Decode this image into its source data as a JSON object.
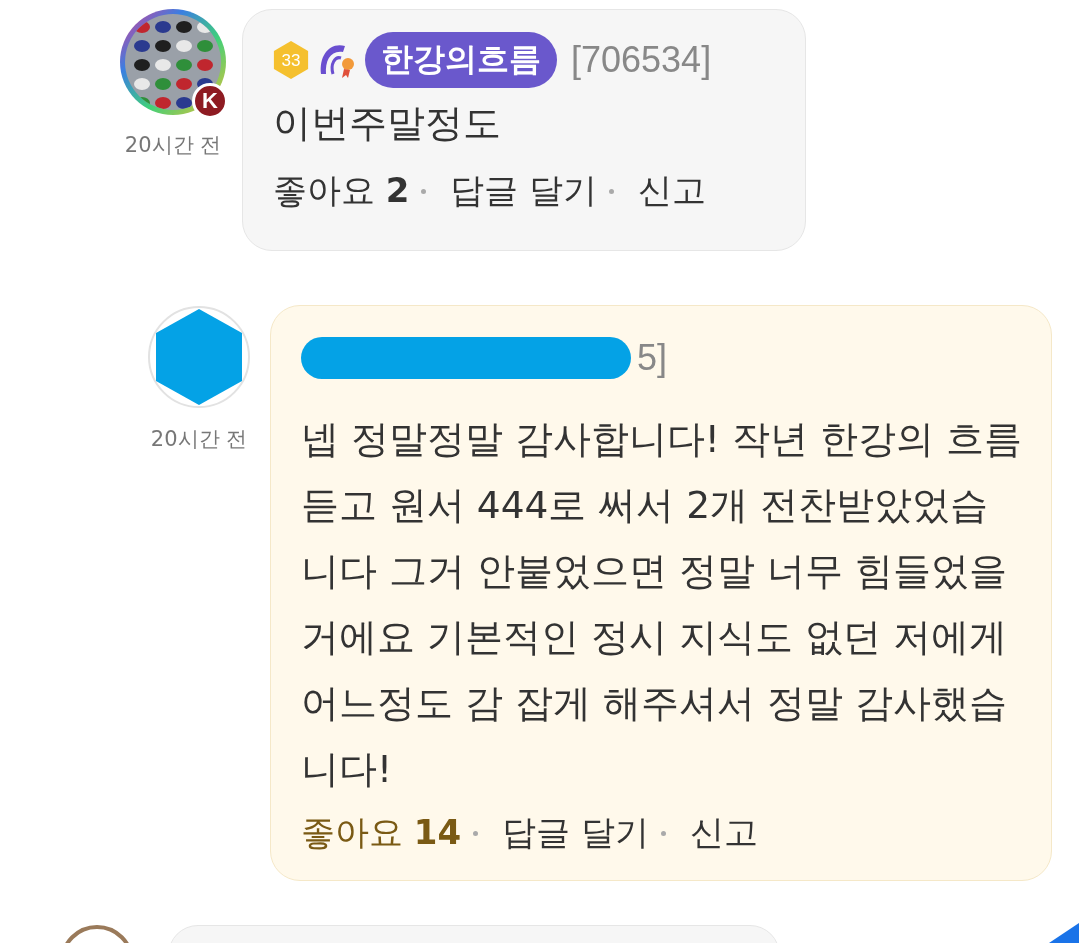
{
  "comments": [
    {
      "avatar": {
        "kind": "picture",
        "badge": "K"
      },
      "time": "20시간 전",
      "level": "33",
      "name": "한강의흐름",
      "user_id": "[706534]",
      "redacted": false,
      "text": "이번주말정도",
      "likes_label": "좋아요",
      "likes": "2",
      "liked": false,
      "reply": "답글 달기",
      "report": "신고",
      "reply_level": false
    },
    {
      "avatar": {
        "kind": "hexagon"
      },
      "time": "20시간 전",
      "user_id": "5]",
      "redacted": true,
      "text": "넵 정말정말 감사합니다! 작년 한강의 흐름 듣고 원서 444로 써서 2개 전찬받았었습니다 그거 안붙었으면 정말 너무 힘들었을거에요 기본적인 정시 지식도 없던 저에게 어느정도 감 잡게 해주셔서 정말 감사했습니다!",
      "likes_label": "좋아요",
      "likes": "14",
      "liked": true,
      "reply": "답글 달기",
      "report": "신고",
      "reply_level": true
    }
  ]
}
